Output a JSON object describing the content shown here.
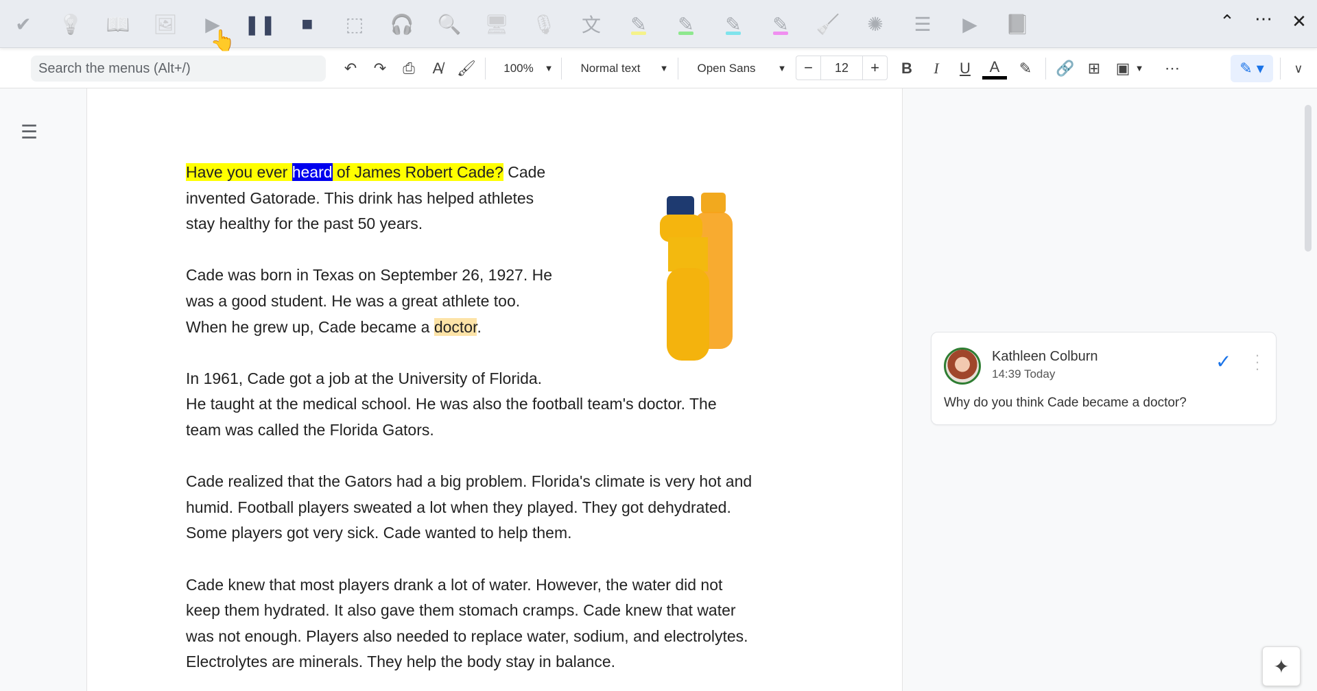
{
  "topbar": {
    "icons": [
      "check-circle-icon",
      "lightbulb-icon",
      "dictionary-icon",
      "picture-dictionary-icon",
      "play-icon",
      "pause-icon",
      "stop-icon",
      "screen-select-icon",
      "audio-maker-icon",
      "web-search-icon",
      "screen-mask-icon",
      "talk-type-icon",
      "translator-icon",
      "highlight-yellow-icon",
      "highlight-green-icon",
      "highlight-blue-icon",
      "highlight-pink-icon",
      "clear-highlights-icon",
      "collect-highlights-icon",
      "vocabulary-list-icon",
      "practice-reading-icon",
      "rewordify-icon"
    ],
    "highlight_colors": {
      "yellow": "#f5f28a",
      "green": "#8ee88e",
      "blue": "#7fe3ec",
      "pink": "#f08ff0"
    }
  },
  "toolbar": {
    "search_placeholder": "Search the menus (Alt+/)",
    "zoom": "100%",
    "style": "Normal text",
    "font": "Open Sans",
    "font_size": "12",
    "minus": "−",
    "plus": "+"
  },
  "document": {
    "paragraphs": [
      {
        "lines": [
          "invented Gatorade. This drink has helped athletes",
          "stay healthy for the past 50 years."
        ],
        "first_line": {
          "pre": "Have you ever ",
          "sel": "heard",
          "post": " of James Robert Cade?",
          "rest": " Cade"
        }
      },
      {
        "lines": [
          "Cade was born in Texas on September 26, 1927. He",
          "was a good student. He was a great athlete too."
        ],
        "last_line": {
          "pre": "When he grew up, Cade became a ",
          "mark": "doctor",
          "post": "."
        }
      },
      {
        "lines": [
          "In 1961, Cade got a job at the University of Florida.",
          "He taught at the medical school. He was also the football team's doctor. The",
          "team was called the Florida Gators."
        ]
      },
      {
        "lines": [
          "Cade realized that the Gators had a big problem. Florida's climate is very hot and",
          "humid. Football players sweated a lot when they played. They got dehydrated.",
          "Some players got very sick. Cade wanted to help them."
        ]
      },
      {
        "lines": [
          "Cade knew that most players drank a lot of water. However, the water did not",
          "keep them hydrated. It also gave them stomach cramps. Cade knew that water",
          "was not enough. Players also needed to replace water, sodium, and electrolytes.",
          "Electrolytes are minerals. They help the body stay in balance."
        ]
      }
    ]
  },
  "comment": {
    "author": "Kathleen Colburn",
    "time": "14:39 Today",
    "text": "Why do you think Cade became a doctor?"
  }
}
